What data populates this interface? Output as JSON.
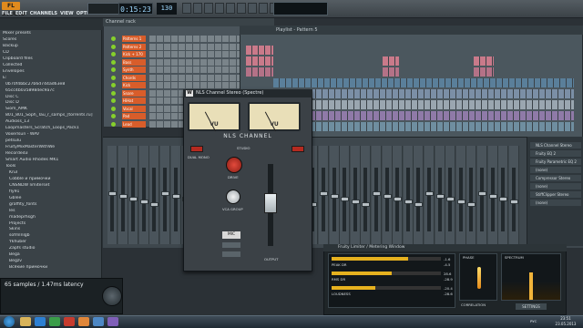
{
  "app": {
    "logo": "FL STUDIO",
    "menus": [
      "FILE",
      "EDIT",
      "CHANNELS",
      "VIEW",
      "OPTIONS",
      "TOOLS",
      "HELP"
    ],
    "time": "0:15:23",
    "tempo": "130"
  },
  "browser": {
    "title": "65 samples / 1.47ms latency",
    "items": [
      "Mixer presets",
      "Scores",
      "Backup",
      "CD",
      "Clipboard files",
      "Collected",
      "Envelopes",
      "E:",
      "0b70f4bbc27b6d744ad63e8",
      "65cc4b0358984ec9a7c",
      "Disc C",
      "Disc D",
      "Siom_AMK",
      "801_801_Soph_Tau_r_samps_[torrents.ru]",
      "Audioss_13",
      "Loopmasters_Scratch_Loops_Pack1",
      "Voxerlsun - WAV",
      "petsulu",
      "FruityMixMasterWithWe",
      "Recorded3",
      "Smart Audio Rhodes MK1",
      "Tools",
      "Krul",
      "Cobble и примочки",
      "CNSNDW limiterset",
      "fly91",
      "Gblee",
      "graffity_fonts",
      "les",
      "madeprhsgh",
      "Projects",
      "Skins",
      "sofmlnlgb",
      "Ykhuber",
      "Zapfs studio",
      "Bega",
      "Begzv",
      "Всякие примочки"
    ]
  },
  "rack": {
    "title": "Channel rack",
    "channels": [
      "Patterns 1",
      "Patterns 2",
      "Kick + 170",
      "Bass",
      "Synth",
      "Chords",
      "Kick",
      "Snare",
      "HiHat",
      "Vocal",
      "Pad",
      "Lead"
    ]
  },
  "playlist": {
    "title": "Playlist - Pattern 5"
  },
  "plugin": {
    "title": "NLS Channel Stereo (Spectre)",
    "brand": "NLS CHANNEL",
    "vu_left": "VU",
    "vu_right": "VU",
    "drive": "DRIVE",
    "vca": "VCA GROUP",
    "output": "OUTPUT",
    "studio": "STUDIO",
    "dual_mono": "DUAL MONO",
    "mic": "MIC",
    "logo": "W"
  },
  "fxslots": [
    "NLS Channel Stereo",
    "Fruity EQ 2",
    "Fruity Parametric EQ 2",
    "(none)",
    "Compressor Stereo",
    "(none)",
    "StiffClipper Stereo",
    "(none)"
  ],
  "meterwin": {
    "title": "Fruity Limiter / Metering Window",
    "readouts": [
      "-1.6",
      "-4.5",
      "28.6",
      "-28.9",
      "-20.4",
      "-28.6"
    ],
    "labels": [
      "PEAK DR",
      "RMS DR",
      "LOUDNESS"
    ],
    "phase_label": "PHASE",
    "correlation": "CORRELATION",
    "spectrum": "SPECTRUM",
    "settings": "SETTINGS"
  },
  "latency": "65 samples / 1.47ms latency",
  "taskbar": {
    "lang": "РУС",
    "time": "23:51",
    "date": "23.05.2013"
  }
}
